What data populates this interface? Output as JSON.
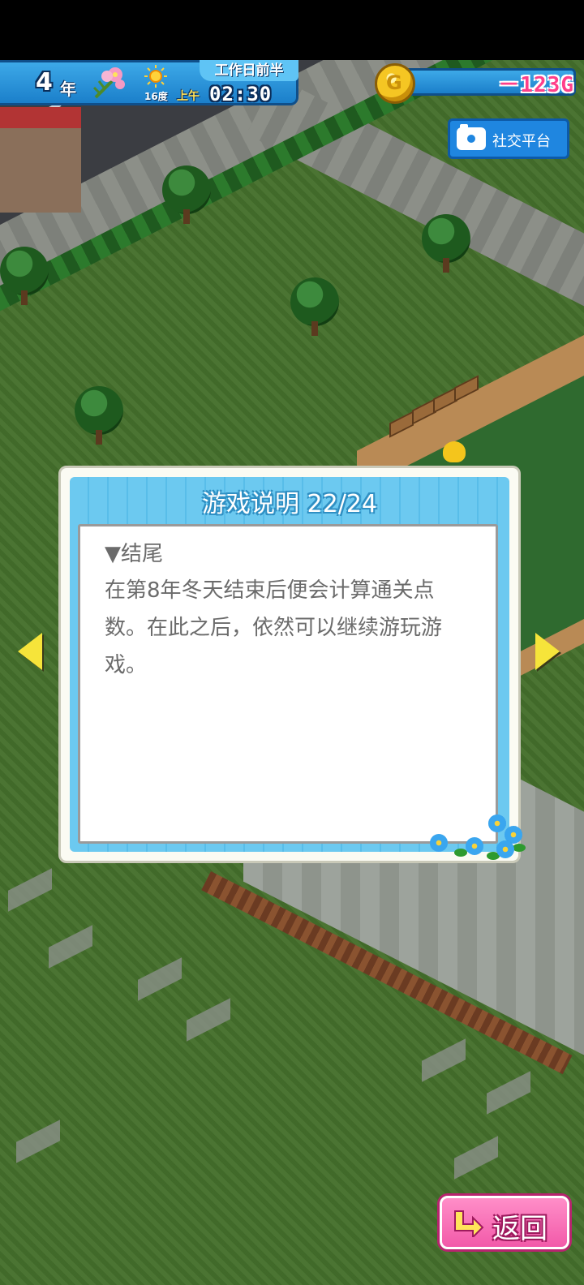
{
  "hud": {
    "year_number": "4",
    "year_unit": "年",
    "season_icon": "flower-icon",
    "weather_icon": "sun-icon",
    "temperature": "16度",
    "period": "工作日前半",
    "ampm": "上午",
    "time": "02:30",
    "money": "－123G",
    "coin_letter": "G"
  },
  "social": {
    "label": "社交平台",
    "icon": "camera-icon"
  },
  "dialog": {
    "title": "游戏说明 22/24",
    "section_heading": "▼结尾",
    "section_text": "在第8年冬天结束后便会计算通关点数。在此之后，依然可以继续游玩游戏。"
  },
  "navigation": {
    "prev_icon": "arrow-left-icon",
    "next_icon": "arrow-right-icon",
    "back_label": "返回"
  },
  "colors": {
    "hud_blue": "#1b7fca",
    "money_pink": "#ff3f8a",
    "dialog_frame": "#6cc9f0",
    "arrow_yellow": "#f6e43a",
    "back_pink": "#f25aa9"
  }
}
